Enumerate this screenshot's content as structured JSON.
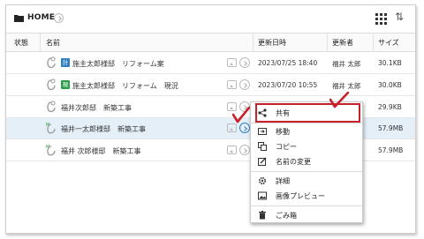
{
  "header": {
    "folder_icon": "folder-icon",
    "location": "HOME",
    "view_icon": "grid-view-icon",
    "sort_icon": "sort-arrows-icon"
  },
  "columns": {
    "status": "状態",
    "name": "名前",
    "updated": "更新日時",
    "updater": "更新者",
    "size": "サイズ"
  },
  "files": [
    {
      "badge": "計",
      "badge_color": "#2e7fc1",
      "name": "施主太郎様邸　リフォーム案",
      "updated": "2023/07/25 18:40",
      "updater": "福井 太郎",
      "size": "30.1KB"
    },
    {
      "badge": "現",
      "badge_color": "#2a9d4a",
      "name": "施主太郎様邸　リフォーム　現況",
      "updated": "2023/07/20 10:55",
      "updater": "福井 太郎",
      "size": "30.0KB"
    },
    {
      "badge": "",
      "badge_color": "",
      "name": "福井次郎邸　新築工事",
      "updated": "",
      "updater": "",
      "size": "29.9KB"
    },
    {
      "badge": "",
      "badge_color": "",
      "name": "福井一太郎様邸　新築工事",
      "updated": "",
      "updater": "",
      "size": "57.9MB"
    },
    {
      "badge": "",
      "badge_color": "",
      "name": "福井 次郎様邸　新築工事",
      "updated": "",
      "updater": "",
      "size": "57.9MB"
    }
  ],
  "selected_row": 3,
  "context_menu": {
    "items": [
      {
        "icon": "share-icon",
        "label": "共有"
      },
      {
        "icon": "move-icon",
        "label": "移動"
      },
      {
        "icon": "copy-icon",
        "label": "コピー"
      },
      {
        "icon": "rename-icon",
        "label": "名前の変更"
      },
      {
        "icon": "gear-icon",
        "label": "詳細"
      },
      {
        "icon": "image-preview-icon",
        "label": "画像プレビュー"
      },
      {
        "icon": "trash-icon",
        "label": "ごみ箱"
      }
    ],
    "highlighted": "共有"
  },
  "annotation_color": "#c8202a"
}
